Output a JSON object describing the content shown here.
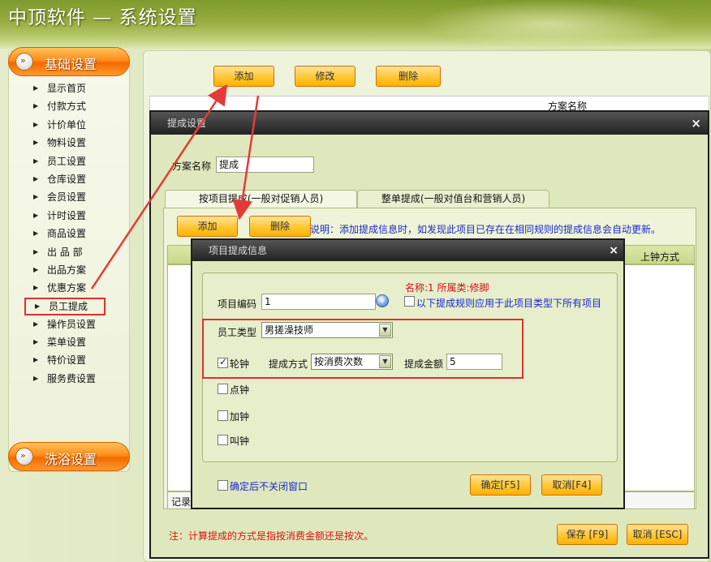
{
  "header": {
    "title": "中顶软件 — 系统设置"
  },
  "sidebar": {
    "group_basic": "基础设置",
    "group_bath": "洗浴设置",
    "items": [
      {
        "label": "显示首页"
      },
      {
        "label": "付款方式"
      },
      {
        "label": "计价单位"
      },
      {
        "label": "物料设置"
      },
      {
        "label": "员工设置"
      },
      {
        "label": "仓库设置"
      },
      {
        "label": "会员设置"
      },
      {
        "label": "计时设置"
      },
      {
        "label": "商品设置"
      },
      {
        "label": "出 品 部"
      },
      {
        "label": "出品方案"
      },
      {
        "label": "优惠方案"
      },
      {
        "label": "员工提成"
      },
      {
        "label": "操作员设置"
      },
      {
        "label": "菜单设置"
      },
      {
        "label": "特价设置"
      },
      {
        "label": "服务费设置"
      }
    ]
  },
  "toolbar": {
    "add": "添加",
    "edit": "修改",
    "delete": "删除"
  },
  "main_table": {
    "col_scheme_name": "方案名称"
  },
  "dialog_commission": {
    "title": "提成设置",
    "scheme_name_label": "方案名称",
    "scheme_name_value": "提成",
    "tabs": [
      "按项目提成(一般对促销人员)",
      "整单提成(一般对值台和营销人员)"
    ],
    "add": "添加",
    "delete": "删除",
    "note": "说明：添加提成信息时，如发现此项目已存在在相同规则的提成信息会自动更新。",
    "col_shift_method": "上钟方式",
    "record_label": "记录",
    "footer_note": "注：计算提成的方式是指按消费金额还是按次。",
    "save": "保存 [F9]",
    "cancel": "取消 [ESC]"
  },
  "dialog_item": {
    "title": "项目提成信息",
    "info_name": "名称:1  所属类:修脚",
    "item_code_label": "项目编码",
    "item_code_value": "1",
    "apply_all_label": "以下提成规则应用于此项目类型下所有项目",
    "staff_type_label": "员工类型",
    "staff_type_value": "男搓澡技师",
    "rotate_label": "轮钟",
    "rotate_checked": true,
    "commission_method_label": "提成方式",
    "commission_method_value": "按消费次数",
    "commission_amount_label": "提成金额",
    "commission_amount_value": "5",
    "point_label": "点钟",
    "extra_label": "加钟",
    "call_label": "叫钟",
    "keep_open_label": "确定后不关闭窗口",
    "ok": "确定[F5]",
    "cancel": "取消[F4]"
  }
}
